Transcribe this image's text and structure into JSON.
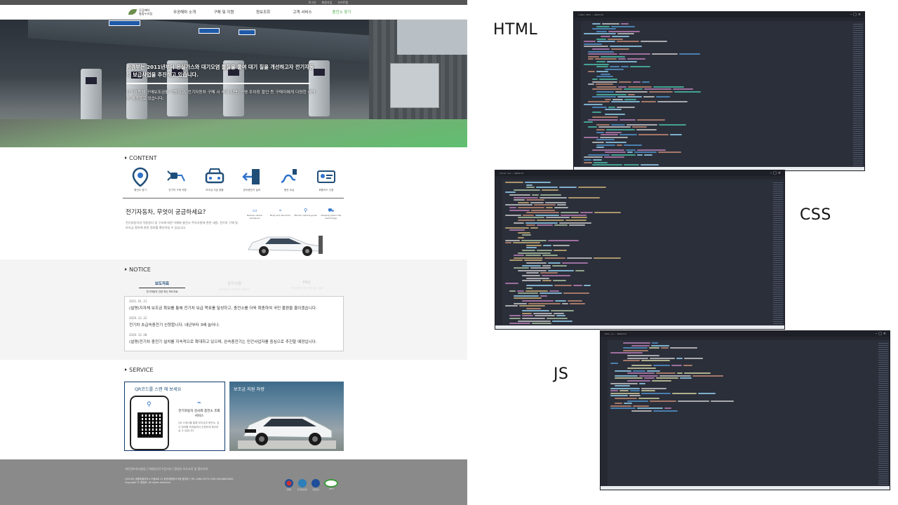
{
  "labels": {
    "html": "HTML",
    "css": "CSS",
    "js": "JS"
  },
  "site": {
    "topbar": [
      "로그인",
      "회원가입",
      "사이트맵"
    ],
    "logo": {
      "line1": "무공해차",
      "line2": "통합누리집"
    },
    "nav": [
      "무공해차 소개",
      "구매 및 지원",
      "정보조회",
      "고객 서비스",
      "충전소 찾기"
    ],
    "hero": {
      "title": "환경부는 2011년부터 온실가스와 대기오염 물질을 줄여 대기 질을 개선하고자 전기자동차 보급사업을 추진하고 있습니다.",
      "desc": "전기자동차 구매보조금을 지원하고, 전기자동차 구매 시 세제 감면, 공영 주차장 할인 등 구매자에게 다양한 혜택을 제공하고 있습니다."
    },
    "content": {
      "heading": "CONTENT",
      "icons": [
        {
          "label": "충전소 찾기",
          "icon": "map-pin-icon"
        },
        {
          "label": "전기차 구매 지원",
          "icon": "ev-plug-icon"
        },
        {
          "label": "보조금 지급 현황",
          "icon": "car-front-icon"
        },
        {
          "label": "완속충전기 설치",
          "icon": "door-exit-icon"
        },
        {
          "label": "충전 요금",
          "icon": "charging-cable-icon"
        },
        {
          "label": "회원카드 신청",
          "icon": "member-card-icon"
        }
      ],
      "ev_title": "전기자동차, 무엇이 궁금하세요?",
      "ev_desc": "전기자동차의 작동원리 및 구조에 대한 이해와 충전시 주의사항에 관한 내용, 전기차 구매 및 보조금 절차에 관한 정보를 확인하실 수 있습니다.",
      "features": [
        {
          "icon": "battery-icon",
          "label": "Reduce carbon emissions"
        },
        {
          "icon": "plug-icon",
          "label": "Body and structure"
        },
        {
          "icon": "pin-icon",
          "label": "Electric vehicle guide"
        },
        {
          "icon": "car-icon",
          "label": "Develop green ride technology"
        }
      ]
    },
    "notice": {
      "heading": "NOTICE",
      "tabs": [
        {
          "label": "보도자료",
          "sub": "전기자동차 관련 최신 보도자료",
          "active": true
        },
        {
          "label": "공지사항",
          "sub": "전기자동차 관련 공지 확인하기",
          "active": false
        },
        {
          "label": "FAQ",
          "sub": "전기자동차 관련 자주 묻는 질문",
          "active": false
        }
      ],
      "items": [
        {
          "date": "2021. 01. 21",
          "text": "(설명)지자체 보조금 확보를 통해 전기차 보급 목표를 달성하고, 충전소를 더욱 확충하여 국민 불편을 줄이겠습니다."
        },
        {
          "date": "2020. 12. 22",
          "text": "전기차 초급속충전기 신청합니다. 내년부터 3배 늘어나."
        },
        {
          "date": "2020. 12. 08",
          "text": "(설명)전기차 충전기 설치를 지속적으로 확대하고 있으며, 완속충전기는 민간사업자를 중심으로 추진할 예정입니다."
        }
      ]
    },
    "service": {
      "heading": "SERVICE",
      "qr_title": "QR코드를 스캔 해 보세요",
      "qr_side_title": "전기자동차 검사와 충전소 조회 서비스",
      "qr_side_desc": "QR 스캐너를 통해 보조금과 충전소, 검사 정보를 모바일에서 간편하게 확인하실 수 있습니다.",
      "sub_title": "보조금 지원 차량"
    },
    "footer": {
      "links": "개인정보처리방침 | 이메일무단수집거부 | 환경부 보도자료 및 홍보자료",
      "info": "(30103) 세종특별자치시 도움6로 11 정부세종청사 6동 환경부 | TEL 1661-0970 | FAX 044-868-0000\nCopyright © 환경부. All rights reserved.",
      "logos": [
        "환경부",
        "한국환경공단",
        "환경정보",
        "KEITI"
      ]
    }
  },
  "windows": {
    "html": {
      "title": "index.html — WebSite",
      "colors": [
        "#569cd6",
        "#9cdcfe",
        "#ce9178",
        "#d4d4d4",
        "#4ec9b0",
        "#c586c0"
      ]
    },
    "css": {
      "title": "style.css — WebSite",
      "colors": [
        "#d7ba7d",
        "#9cdcfe",
        "#ce9178",
        "#b5cea8",
        "#c586c0",
        "#d4d4d4"
      ]
    },
    "js": {
      "title": "main.js — WebSite",
      "colors": [
        "#569cd6",
        "#9cdcfe",
        "#dcdcaa",
        "#ce9178",
        "#d4d4d4",
        "#c586c0"
      ]
    }
  }
}
